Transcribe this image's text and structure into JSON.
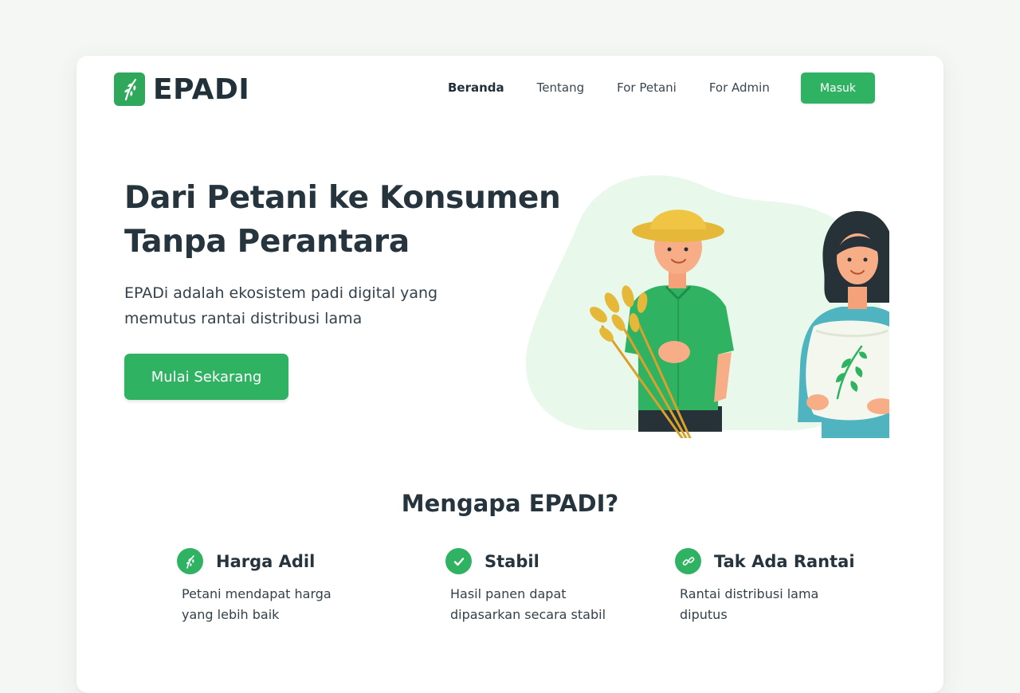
{
  "brand": {
    "name": "EPADI",
    "accent_color": "#2fb262",
    "logo_icon": "rice-plant-icon"
  },
  "nav": {
    "items": [
      {
        "label": "Beranda",
        "active": true
      },
      {
        "label": "Tentang",
        "active": false
      },
      {
        "label": "For Petani",
        "active": false
      },
      {
        "label": "For Admin",
        "active": false
      }
    ],
    "login_label": "Masuk"
  },
  "hero": {
    "title_line1": "Dari Petani ke Konsumen",
    "title_line2": "Tanpa Perantara",
    "subtitle_line1": "EPADi adalah ekosistem padi digital yang",
    "subtitle_line2": "memutus rantai distribusi lama",
    "cta_label": "Mulai Sekarang",
    "illustration": "farmer-with-rice-and-woman-with-rice-sack"
  },
  "why": {
    "title": "Mengapa EPADI?",
    "features": [
      {
        "icon": "rice-plant-icon",
        "title": "Harga Adil",
        "desc_line1": "Petani mendapat harga",
        "desc_line2": "yang lebih baik"
      },
      {
        "icon": "check-icon",
        "title": "Stabil",
        "desc_line1": "Hasil panen dapat",
        "desc_line2": "dipasarkan secara stabil"
      },
      {
        "icon": "broken-chain-icon",
        "title": "Tak Ada Rantai",
        "desc_line1": "Rantai distribusi lama",
        "desc_line2": "diputus"
      }
    ]
  }
}
